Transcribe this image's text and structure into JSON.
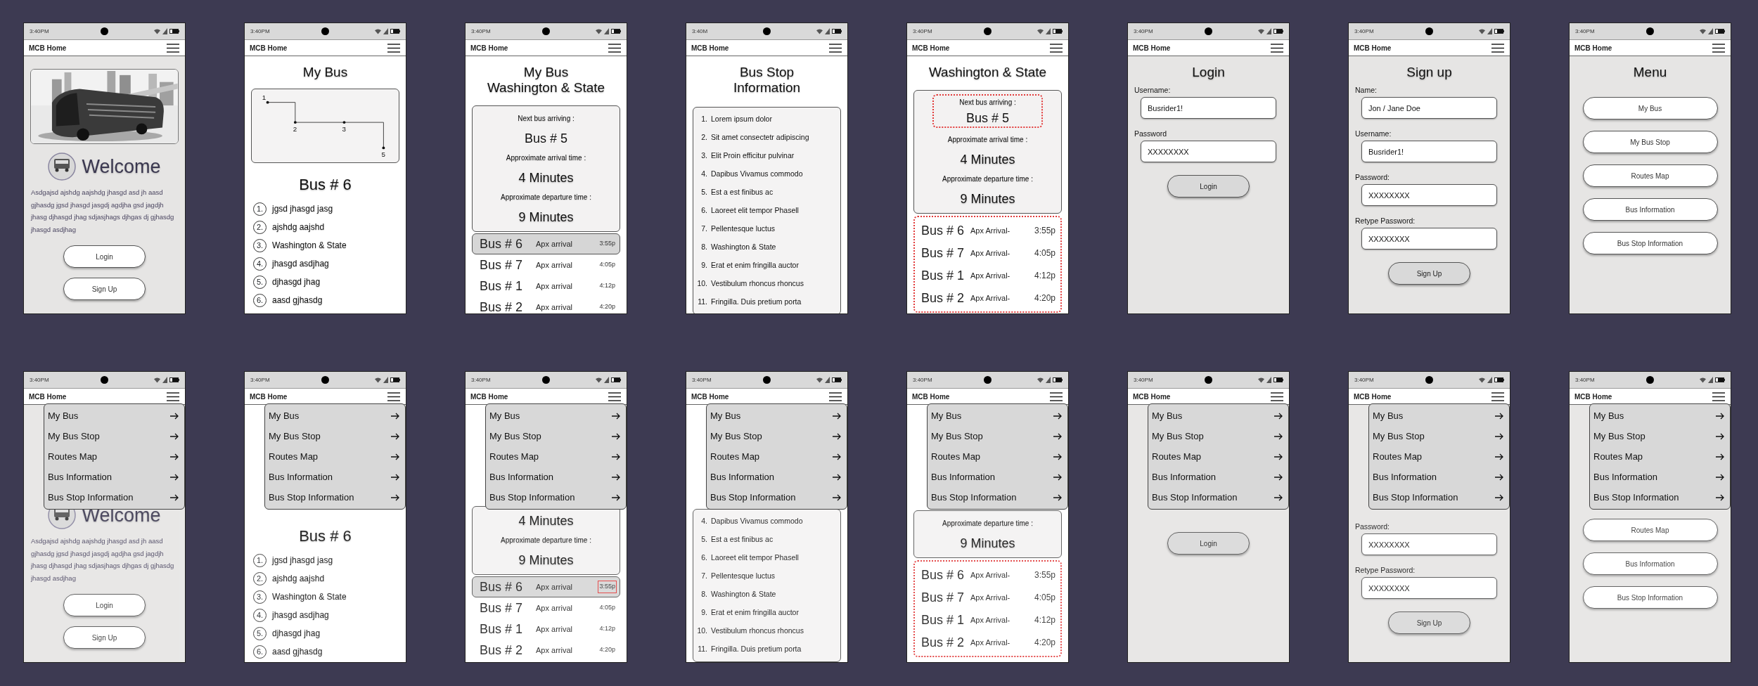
{
  "phones": [
    {
      "kind": "welcome",
      "time": "3:40PM",
      "app_title": "MCB Home",
      "blurred": false,
      "blocks": [
        {
          "kind": "picture"
        },
        {
          "kind": "welcome",
          "title": "Welcome"
        },
        {
          "kind": "paragraph",
          "text": "Asdgajsd ajshdg aajshdg jhasgd asd jh aasd gjhasdg jgsd jhasgd jasgdj agdjha gsd jagdjh jhasg djhasgd jhag sdjasjhags djhgas dj gjhasdg jhasgd asdjhag"
        },
        {
          "kind": "pill-button",
          "label": "Login"
        },
        {
          "kind": "pill-button",
          "label": "Sign Up"
        }
      ]
    },
    {
      "kind": "my-bus",
      "time": "3:40PM",
      "app_title": "MCB Home",
      "blurred": false,
      "blocks": [
        {
          "kind": "title",
          "lines": [
            "My Bus"
          ]
        },
        {
          "kind": "route-map",
          "stops": [
            "1",
            "2",
            "3",
            "5"
          ]
        },
        {
          "kind": "heading",
          "text": "Bus # 6"
        },
        {
          "kind": "stop-list",
          "items": [
            {
              "number": "1.",
              "text": "jgsd jhasgd jasg"
            },
            {
              "number": "2.",
              "text": "ajshdg aajshd"
            },
            {
              "number": "3.",
              "text": "Washington & State"
            },
            {
              "number": "4.",
              "text": "jhasgd asdjhag"
            },
            {
              "number": "5.",
              "text": "djhasgd jhag"
            },
            {
              "number": "6.",
              "text": "aasd gjhasdg"
            }
          ]
        }
      ]
    },
    {
      "kind": "bus-info",
      "time": "3:40PM",
      "app_title": "MCB Home",
      "blurred": false,
      "blocks": [
        {
          "kind": "title",
          "lines": [
            "My Bus",
            "Washington & State"
          ]
        },
        {
          "kind": "info-card",
          "groups": [
            {
              "outlined": false,
              "lines": [
                {
                  "kind": "label",
                  "text": "Next bus arriving :"
                },
                {
                  "kind": "value",
                  "text": "Bus # 5"
                },
                {
                  "kind": "label",
                  "text": "Approximate arrival time :"
                },
                {
                  "kind": "big-value",
                  "text": "4 Minutes"
                },
                {
                  "kind": "label",
                  "text": "Approximate departure time :"
                },
                {
                  "kind": "big-value",
                  "text": "9 Minutes"
                }
              ]
            }
          ]
        },
        {
          "kind": "bus-list",
          "outlined": false,
          "rows": [
            {
              "bus": "Bus # 6",
              "label": "Apx arrival",
              "time": "3:55p",
              "selected": true,
              "flagged": false
            },
            {
              "bus": "Bus # 7",
              "label": "Apx arrival",
              "time": "4:05p",
              "selected": false,
              "flagged": false
            },
            {
              "bus": "Bus # 1",
              "label": "Apx arrival",
              "time": "4:12p",
              "selected": false,
              "flagged": false
            },
            {
              "bus": "Bus # 2",
              "label": "Apx arrival",
              "time": "4:20p",
              "selected": false,
              "flagged": false
            }
          ]
        }
      ]
    },
    {
      "kind": "stop-info",
      "time": "3:40M",
      "app_title": "MCB Home",
      "blurred": false,
      "blocks": [
        {
          "kind": "title",
          "lines": [
            "Bus Stop",
            "Information"
          ]
        },
        {
          "kind": "stop-card",
          "items": [
            {
              "number": "1.",
              "text": "Lorem ipsum dolor"
            },
            {
              "number": "2.",
              "text": "Sit amet consectetr adipiscing"
            },
            {
              "number": "3.",
              "text": "Elit Proin efficitur pulvinar"
            },
            {
              "number": "4.",
              "text": "Dapibus Vivamus commodo"
            },
            {
              "number": "5.",
              "text": "Est a est finibus ac"
            },
            {
              "number": "6.",
              "text": "Laoreet elit tempor Phasell"
            },
            {
              "number": "7.",
              "text": "Pellentesque luctus"
            },
            {
              "number": "8.",
              "text": "Washington & State"
            },
            {
              "number": "9.",
              "text": "Erat et enim fringilla auctor"
            },
            {
              "number": "10.",
              "text": "Vestibulum rhoncus rhoncus"
            },
            {
              "number": "11.",
              "text": "Fringilla. Duis pretium porta"
            }
          ]
        }
      ]
    },
    {
      "kind": "stop-detail",
      "time": "3:40PM",
      "app_title": "MCB Home",
      "blurred": false,
      "blocks": [
        {
          "kind": "title",
          "lines": [
            "Washington & State"
          ]
        },
        {
          "kind": "info-card",
          "groups": [
            {
              "outlined": true,
              "lines": [
                {
                  "kind": "label",
                  "text": "Next bus arriving :"
                },
                {
                  "kind": "value",
                  "text": "Bus # 5"
                }
              ]
            },
            {
              "outlined": false,
              "lines": [
                {
                  "kind": "label",
                  "text": "Approximate arrival time :"
                },
                {
                  "kind": "big-value",
                  "text": "4 Minutes"
                },
                {
                  "kind": "label",
                  "text": "Approximate departure time :"
                },
                {
                  "kind": "big-value",
                  "text": "9 Minutes"
                }
              ]
            }
          ]
        },
        {
          "kind": "bus-list",
          "outlined": true,
          "rows": [
            {
              "bus": "Bus # 6",
              "label": "Apx Arrival-",
              "time": "3:55p",
              "selected": false,
              "flagged": false
            },
            {
              "bus": "Bus # 7",
              "label": "Apx Arrival-",
              "time": "4:05p",
              "selected": false,
              "flagged": false
            },
            {
              "bus": "Bus # 1",
              "label": "Apx Arrival-",
              "time": "4:12p",
              "selected": false,
              "flagged": false
            },
            {
              "bus": "Bus # 2",
              "label": "Apx Arrival-",
              "time": "4:20p",
              "selected": false,
              "flagged": false
            }
          ]
        }
      ]
    },
    {
      "kind": "login",
      "time": "3:40PM",
      "app_title": "MCB Home",
      "blurred": false,
      "blocks": [
        {
          "kind": "title",
          "lines": [
            "Login"
          ]
        },
        {
          "kind": "field",
          "label": "Username:",
          "value": "Busrider1!"
        },
        {
          "kind": "field",
          "label": "Password",
          "value": "XXXXXXXX"
        },
        {
          "kind": "submit-button",
          "label": "Login"
        }
      ]
    },
    {
      "kind": "signup",
      "time": "3:40PM",
      "app_title": "MCB Home",
      "blurred": false,
      "blocks": [
        {
          "kind": "title",
          "lines": [
            "Sign up"
          ]
        },
        {
          "kind": "field",
          "label": "Name:",
          "value": "Jon / Jane Doe"
        },
        {
          "kind": "field",
          "label": "Username:",
          "value": "Busrider1!"
        },
        {
          "kind": "field",
          "label": "Password:",
          "value": "XXXXXXXX"
        },
        {
          "kind": "field",
          "label": "Retype Password:",
          "value": "XXXXXXXX"
        },
        {
          "kind": "submit-button",
          "label": "Sign Up"
        }
      ]
    },
    {
      "kind": "menu",
      "time": "3:40PM",
      "app_title": "MCB Home",
      "blurred": false,
      "blocks": [
        {
          "kind": "title",
          "lines": [
            "Menu"
          ]
        },
        {
          "kind": "pill-button",
          "label": "My Bus"
        },
        {
          "kind": "pill-button",
          "label": "My Bus Stop"
        },
        {
          "kind": "pill-button",
          "label": "Routes Map"
        },
        {
          "kind": "pill-button",
          "label": "Bus Information"
        },
        {
          "kind": "pill-button",
          "label": "Bus Stop Information"
        }
      ]
    },
    {
      "kind": "welcome",
      "time": "3:40PM",
      "app_title": "MCB Home",
      "blurred": true,
      "menu": [
        {
          "label": "My Bus"
        },
        {
          "label": "My Bus Stop"
        },
        {
          "label": "Routes Map"
        },
        {
          "label": "Bus Information"
        },
        {
          "label": "Bus Stop Information"
        }
      ],
      "blocks": [
        {
          "kind": "welcome",
          "title": "Welcome"
        },
        {
          "kind": "paragraph",
          "text": "Asdgajsd ajshdg aajshdg jhasgd asd jh aasd gjhasdg jgsd jhasgd jasgdj agdjha gsd jagdjh jhasg djhasgd jhag sdjasjhags djhgas dj gjhasdg jhasgd asdjhag"
        },
        {
          "kind": "pill-button",
          "label": "Login"
        },
        {
          "kind": "pill-button",
          "label": "Sign Up"
        }
      ]
    },
    {
      "kind": "my-bus",
      "time": "3:40PM",
      "app_title": "MCB Home",
      "blurred": true,
      "menu": [
        {
          "label": "My Bus"
        },
        {
          "label": "My Bus Stop"
        },
        {
          "label": "Routes Map"
        },
        {
          "label": "Bus Information"
        },
        {
          "label": "Bus Stop Information"
        }
      ],
      "blocks": [
        {
          "kind": "heading",
          "text": "Bus # 6"
        },
        {
          "kind": "stop-list",
          "items": [
            {
              "number": "1.",
              "text": "jgsd jhasgd jasg"
            },
            {
              "number": "2.",
              "text": "ajshdg aajshd"
            },
            {
              "number": "3.",
              "text": "Washington & State"
            },
            {
              "number": "4.",
              "text": "jhasgd asdjhag"
            },
            {
              "number": "5.",
              "text": "djhasgd jhag"
            },
            {
              "number": "6.",
              "text": "aasd gjhasdg"
            }
          ]
        }
      ]
    },
    {
      "kind": "bus-info",
      "time": "3:40PM",
      "app_title": "MCB Home",
      "blurred": true,
      "menu": [
        {
          "label": "My Bus"
        },
        {
          "label": "My Bus Stop"
        },
        {
          "label": "Routes Map"
        },
        {
          "label": "Bus Information"
        },
        {
          "label": "Bus Stop Information"
        }
      ],
      "blocks": [
        {
          "kind": "info-card",
          "groups": [
            {
              "outlined": false,
              "lines": [
                {
                  "kind": "big-value",
                  "text": "4 Minutes"
                },
                {
                  "kind": "label",
                  "text": "Approximate departure time :"
                },
                {
                  "kind": "big-value",
                  "text": "9 Minutes"
                }
              ]
            }
          ]
        },
        {
          "kind": "bus-list",
          "outlined": false,
          "rows": [
            {
              "bus": "Bus # 6",
              "label": "Apx arrival",
              "time": "3:55p",
              "selected": true,
              "flagged": true
            },
            {
              "bus": "Bus # 7",
              "label": "Apx arrival",
              "time": "4:05p",
              "selected": false,
              "flagged": false
            },
            {
              "bus": "Bus # 1",
              "label": "Apx arrival",
              "time": "4:12p",
              "selected": false,
              "flagged": false
            },
            {
              "bus": "Bus # 2",
              "label": "Apx arrival",
              "time": "4:20p",
              "selected": false,
              "flagged": false
            }
          ]
        }
      ]
    },
    {
      "kind": "stop-info",
      "time": "3:40PM",
      "app_title": "MCB Home",
      "blurred": true,
      "menu": [
        {
          "label": "My Bus"
        },
        {
          "label": "My Bus Stop"
        },
        {
          "label": "Routes Map"
        },
        {
          "label": "Bus Information"
        },
        {
          "label": "Bus Stop Information"
        }
      ],
      "blocks": [
        {
          "kind": "stop-card",
          "items": [
            {
              "number": "4.",
              "text": "Dapibus Vivamus commodo"
            },
            {
              "number": "5.",
              "text": "Est a est finibus ac"
            },
            {
              "number": "6.",
              "text": "Laoreet elit tempor Phasell"
            },
            {
              "number": "7.",
              "text": "Pellentesque luctus"
            },
            {
              "number": "8.",
              "text": "Washington & State"
            },
            {
              "number": "9.",
              "text": "Erat et enim fringilla auctor"
            },
            {
              "number": "10.",
              "text": "Vestibulum rhoncus rhoncus"
            },
            {
              "number": "11.",
              "text": "Fringilla. Duis pretium porta"
            }
          ]
        }
      ]
    },
    {
      "kind": "stop-detail",
      "time": "3:40PM",
      "app_title": "MCB Home",
      "blurred": true,
      "menu": [
        {
          "label": "My Bus"
        },
        {
          "label": "My Bus Stop"
        },
        {
          "label": "Routes Map"
        },
        {
          "label": "Bus Information"
        },
        {
          "label": "Bus Stop Information"
        }
      ],
      "blocks": [
        {
          "kind": "info-card",
          "groups": [
            {
              "outlined": false,
              "lines": [
                {
                  "kind": "label",
                  "text": "Approximate departure time :"
                },
                {
                  "kind": "big-value",
                  "text": "9 Minutes"
                }
              ]
            }
          ]
        },
        {
          "kind": "bus-list",
          "outlined": true,
          "rows": [
            {
              "bus": "Bus # 6",
              "label": "Apx Arrival-",
              "time": "3:55p",
              "selected": false,
              "flagged": false
            },
            {
              "bus": "Bus # 7",
              "label": "Apx Arrival-",
              "time": "4:05p",
              "selected": false,
              "flagged": false
            },
            {
              "bus": "Bus # 1",
              "label": "Apx Arrival-",
              "time": "4:12p",
              "selected": false,
              "flagged": false
            },
            {
              "bus": "Bus # 2",
              "label": "Apx Arrival-",
              "time": "4:20p",
              "selected": false,
              "flagged": false
            }
          ]
        }
      ]
    },
    {
      "kind": "login",
      "time": "3:40PM",
      "app_title": "MCB Home",
      "blurred": true,
      "menu": [
        {
          "label": "My Bus"
        },
        {
          "label": "My Bus Stop"
        },
        {
          "label": "Routes Map"
        },
        {
          "label": "Bus Information"
        },
        {
          "label": "Bus Stop Information"
        }
      ],
      "blocks": [
        {
          "kind": "submit-button",
          "label": "Login"
        }
      ]
    },
    {
      "kind": "signup",
      "time": "3:40PM",
      "app_title": "MCB Home",
      "blurred": true,
      "menu": [
        {
          "label": "My Bus"
        },
        {
          "label": "My Bus Stop"
        },
        {
          "label": "Routes Map"
        },
        {
          "label": "Bus Information"
        },
        {
          "label": "Bus Stop Information"
        }
      ],
      "blocks": [
        {
          "kind": "field",
          "label": "Password:",
          "value": "XXXXXXXX"
        },
        {
          "kind": "field",
          "label": "Retype Password:",
          "value": "XXXXXXXX"
        },
        {
          "kind": "submit-button",
          "label": "Sign Up"
        }
      ]
    },
    {
      "kind": "menu",
      "time": "3:40PM",
      "app_title": "MCB Home",
      "blurred": true,
      "menu": [
        {
          "label": "My Bus"
        },
        {
          "label": "My Bus Stop"
        },
        {
          "label": "Routes Map"
        },
        {
          "label": "Bus Information"
        },
        {
          "label": "Bus Stop Information"
        }
      ],
      "blocks": [
        {
          "kind": "pill-button",
          "label": "Routes Map"
        },
        {
          "kind": "pill-button",
          "label": "Bus Information"
        },
        {
          "kind": "pill-button",
          "label": "Bus Stop Information"
        }
      ]
    }
  ]
}
